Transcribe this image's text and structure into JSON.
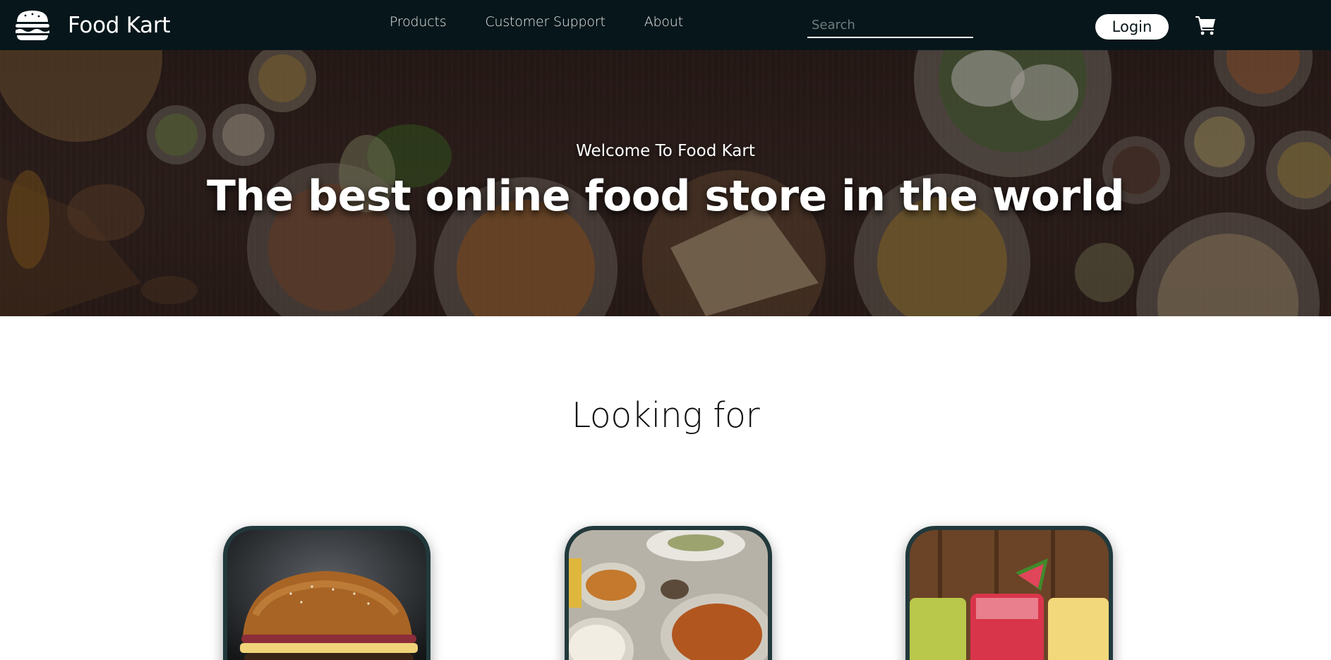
{
  "navbar": {
    "brand_name": "Food Kart",
    "logo_icon": "burger-icon",
    "links": [
      "Products",
      "Customer Support",
      "About"
    ],
    "search_placeholder": "Search",
    "search_value": "",
    "search_icon": "search-icon",
    "login_label": "Login",
    "cart_icon": "shopping-cart-icon"
  },
  "hero": {
    "welcome": "Welcome To Food Kart",
    "headline": "The best online food store in the world"
  },
  "categories": {
    "title": "Looking for",
    "cards": [
      {
        "image": "burger-photo"
      },
      {
        "image": "indian-thali-photo"
      },
      {
        "image": "juice-drinks-photo"
      }
    ]
  },
  "colors": {
    "navbar_bg": "#07161a",
    "card_frame": "#22393c",
    "hero_wood": "#33241f"
  }
}
